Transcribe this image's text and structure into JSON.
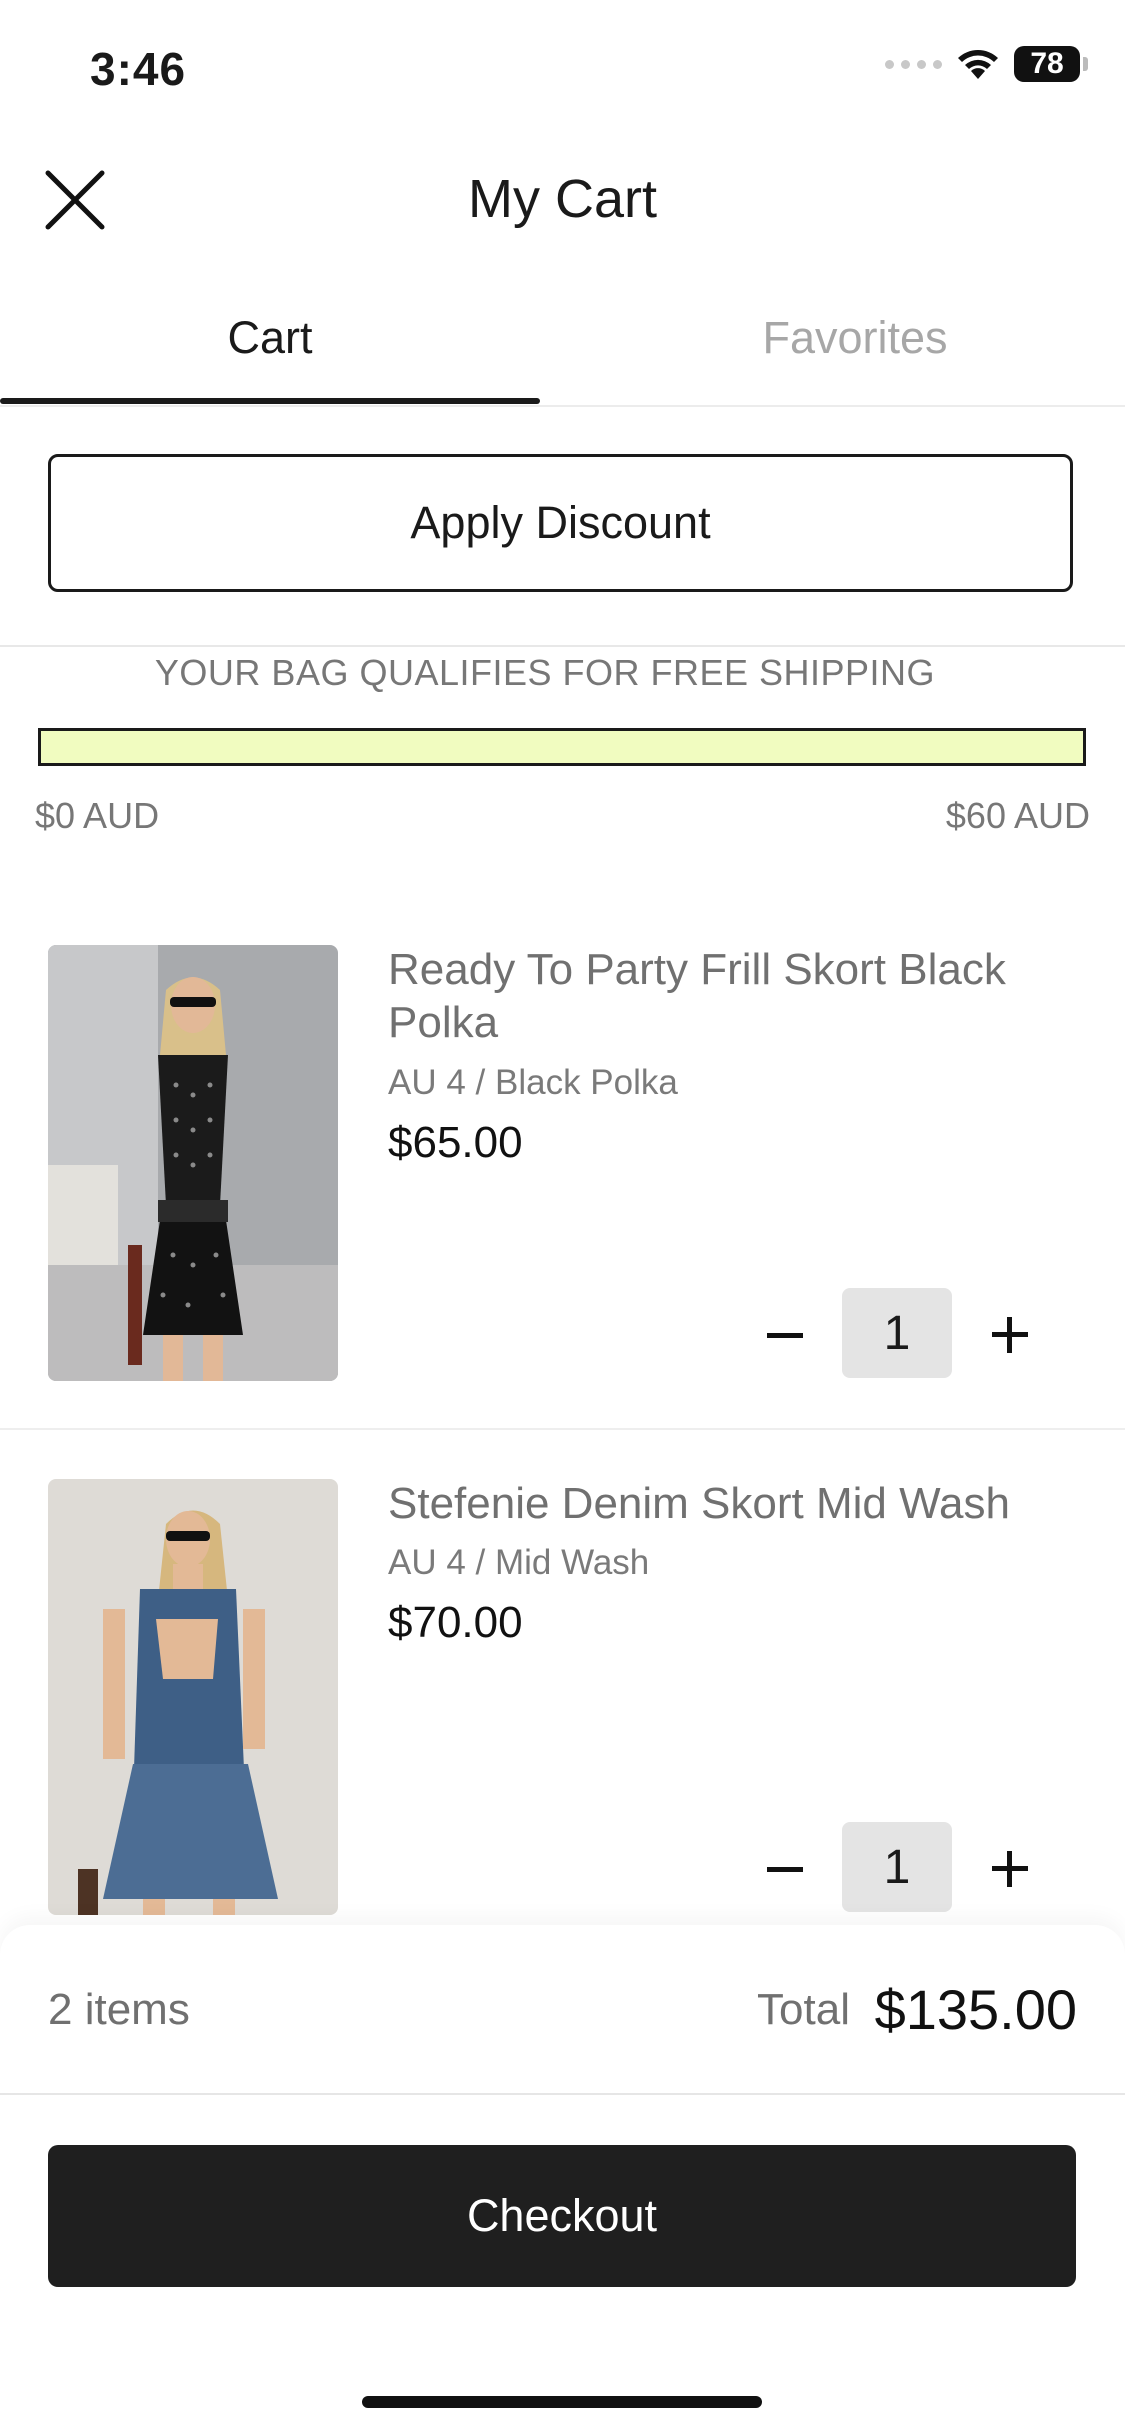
{
  "status_bar": {
    "time": "3:46",
    "battery": "78"
  },
  "header": {
    "title": "My Cart"
  },
  "tabs": [
    {
      "label": "Cart",
      "active": true
    },
    {
      "label": "Favorites",
      "active": false
    }
  ],
  "discount": {
    "label": "Apply Discount"
  },
  "shipping": {
    "message": "YOUR BAG QUALIFIES FOR FREE SHIPPING",
    "min_label": "$0 AUD",
    "max_label": "$60 AUD",
    "progress": 1.0,
    "bar_color": "#f1fcc0"
  },
  "items": [
    {
      "name": "Ready To Party Frill Skort Black Polka",
      "variant": "AU 4 / Black Polka",
      "price": "$65.00",
      "qty": "1"
    },
    {
      "name": "Stefenie Denim Skort Mid Wash",
      "variant": "AU 4 / Mid Wash",
      "price": "$70.00",
      "qty": "1"
    }
  ],
  "summary": {
    "count": "2 items",
    "total_label": "Total",
    "total_value": "$135.00"
  },
  "checkout": {
    "label": "Checkout"
  },
  "colors": {
    "primary": "#1f1f1f",
    "accent": "#f1fcc0",
    "muted": "#a7a7a7"
  }
}
